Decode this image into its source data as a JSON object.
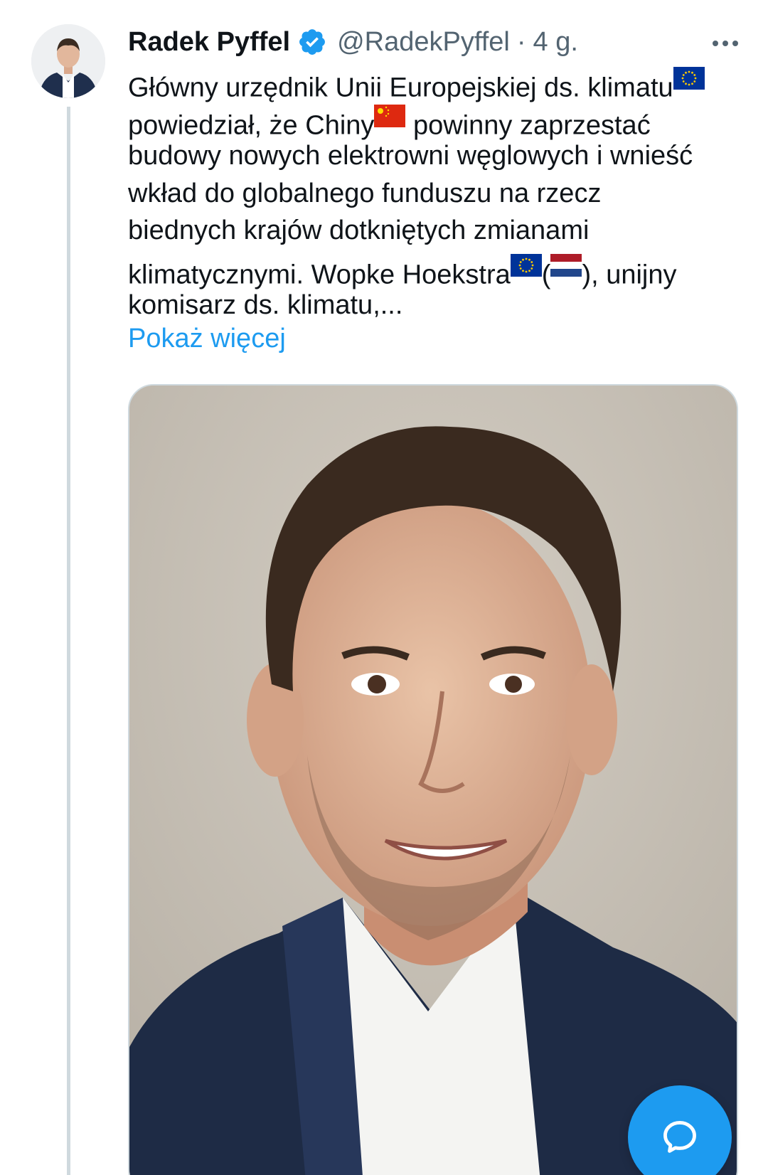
{
  "author": {
    "display_name": "Radek Pyffel",
    "handle": "@RadekPyffel",
    "separator": "·",
    "time": "4 g.",
    "verified": true
  },
  "tweet": {
    "lines": [
      [
        "Główny urzędnik Unii Europejskiej ds. klimatu",
        "{eu}"
      ],
      [
        "powiedział, że Chiny",
        "{cn}",
        " powinny zaprzestać"
      ],
      [
        "budowy nowych elektrowni węglowych i wnieść"
      ],
      [
        "wkład do globalnego funduszu na rzecz"
      ],
      [
        "biednych krajów dotkniętych zmianami"
      ],
      [
        "klimatycznymi. Wopke Hoekstra",
        "{eu}",
        "(",
        "{nl}",
        "), unijny"
      ],
      [
        "komisarz ds. klimatu,..."
      ]
    ],
    "show_more_label": "Pokaż więcej"
  },
  "icons": {
    "verified": "verified-badge-icon",
    "more": "more-options-icon",
    "compose": "compose-reply-icon",
    "flags": {
      "eu": "eu-flag-icon",
      "cn": "china-flag-icon",
      "nl": "netherlands-flag-icon"
    }
  },
  "colors": {
    "accent": "#1d9bf0",
    "text": "#0f1419",
    "secondary": "#536471",
    "border": "#cfd9de"
  }
}
